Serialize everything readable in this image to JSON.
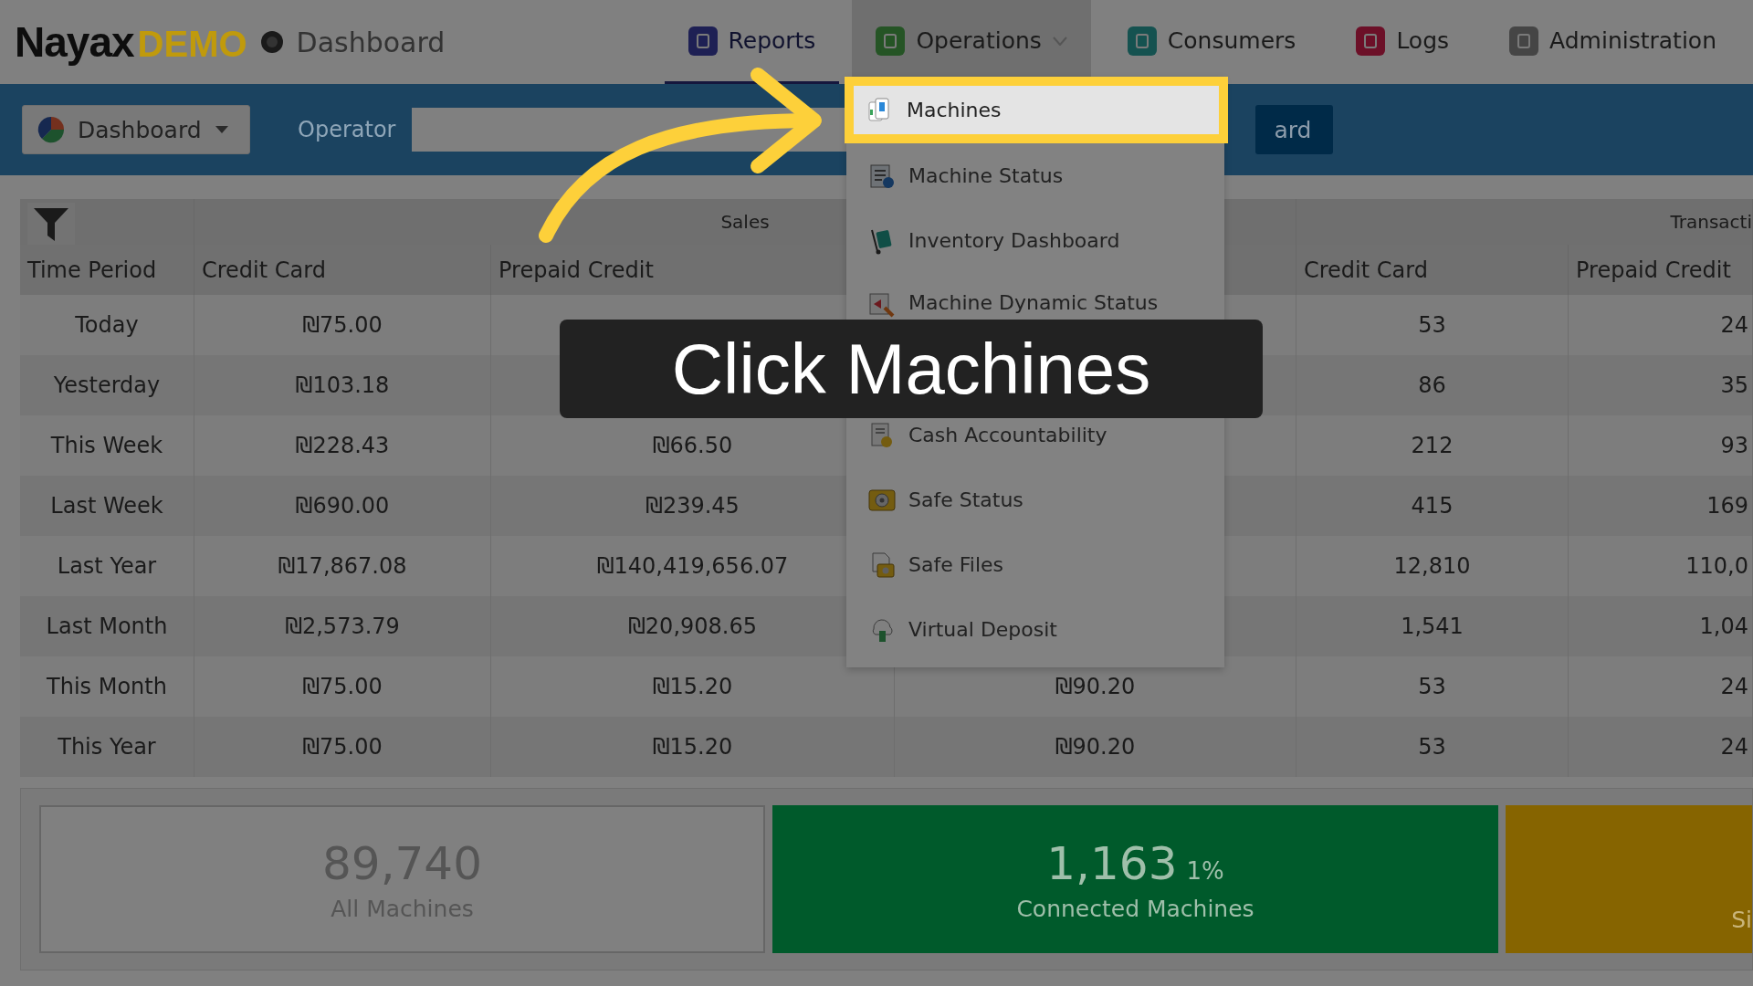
{
  "header": {
    "logo": {
      "name": "Nayax",
      "suffix": "DEMO"
    },
    "page_title": "Dashboard"
  },
  "nav_tabs": [
    {
      "label": "Reports",
      "selected": true,
      "expanded": false,
      "dropdown": false,
      "color": "#1e2054"
    },
    {
      "label": "Operations",
      "selected": false,
      "expanded": true,
      "dropdown": true,
      "color": "#255425"
    },
    {
      "label": "Consumers",
      "selected": false,
      "expanded": false,
      "dropdown": false,
      "color": "#155250"
    },
    {
      "label": "Logs",
      "selected": false,
      "expanded": false,
      "dropdown": false,
      "color": "#6c1028"
    },
    {
      "label": "Administration",
      "selected": false,
      "expanded": false,
      "dropdown": false,
      "color": "#454545"
    }
  ],
  "toolbar": {
    "view_select": "Dashboard",
    "operator_label": "Operator",
    "action_button": "ard"
  },
  "operations_menu": [
    {
      "label": "Machines",
      "selected": true,
      "kind": "machines",
      "gap_after": false
    },
    {
      "label": "Machine Status",
      "selected": false,
      "kind": "status",
      "gap_after": false
    },
    {
      "label": "Inventory Dashboard",
      "selected": false,
      "kind": "inventory",
      "gap_after": false
    },
    {
      "label": "Machine Dynamic Status",
      "selected": false,
      "kind": "dynamic",
      "gap_after": true
    },
    {
      "label": "Cash Accountability",
      "selected": false,
      "kind": "cash",
      "gap_after": false
    },
    {
      "label": "Safe Status",
      "selected": false,
      "kind": "safe",
      "gap_after": false
    },
    {
      "label": "Safe Files",
      "selected": false,
      "kind": "files",
      "gap_after": false
    },
    {
      "label": "Virtual Deposit",
      "selected": false,
      "kind": "deposit",
      "gap_after": false
    }
  ],
  "table": {
    "groups": [
      "Sales",
      "Transacti"
    ],
    "columns": [
      "Time Period",
      "Credit Card",
      "Prepaid Credit",
      null,
      "Credit Card",
      "Prepaid Credit"
    ],
    "rows": [
      [
        "Today",
        "₪75.00",
        null,
        null,
        "53",
        "24"
      ],
      [
        "Yesterday",
        "₪103.18",
        null,
        null,
        "86",
        "35"
      ],
      [
        "This Week",
        "₪228.43",
        "₪66.50",
        null,
        "212",
        "93"
      ],
      [
        "Last Week",
        "₪690.00",
        "₪239.45",
        null,
        "415",
        "169"
      ],
      [
        "Last Year",
        "₪17,867.08",
        "₪140,419,656.07",
        null,
        "12,810",
        "110,0"
      ],
      [
        "Last Month",
        "₪2,573.79",
        "₪20,908.65",
        null,
        "1,541",
        "1,04"
      ],
      [
        "This Month",
        "₪75.00",
        "₪15.20",
        "₪90.20",
        "53",
        "24"
      ],
      [
        "This Year",
        "₪75.00",
        "₪15.20",
        "₪90.20",
        "53",
        "24"
      ]
    ]
  },
  "summary_cards": [
    {
      "kind": "neutral",
      "value": "89,740",
      "label": "All Machines"
    },
    {
      "kind": "success",
      "value": "1,163",
      "percent": "1%",
      "label": "Connected Machines"
    },
    {
      "kind": "warning",
      "label": "Si"
    }
  ],
  "callout": {
    "text": "Click Machines"
  }
}
